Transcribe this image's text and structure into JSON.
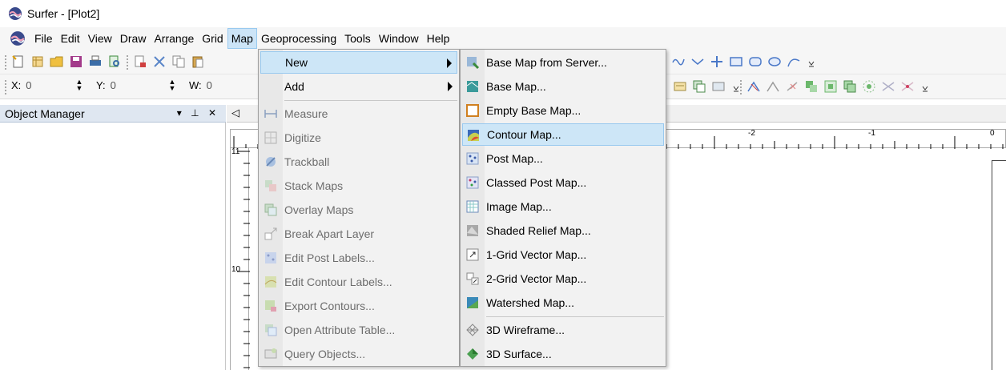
{
  "window": {
    "title": "Surfer - [Plot2]"
  },
  "menubar": {
    "items": [
      "File",
      "Edit",
      "View",
      "Draw",
      "Arrange",
      "Grid",
      "Map",
      "Geoprocessing",
      "Tools",
      "Window",
      "Help"
    ],
    "active": "Map"
  },
  "coords": {
    "x_label": "X:",
    "x_value": "0",
    "y_label": "Y:",
    "y_value": "0",
    "w_label": "W:",
    "w_value": "0"
  },
  "object_manager": {
    "title": "Object Manager",
    "controls": "▾ ⊥ ✕"
  },
  "plot_tab": {
    "arrow": "◁"
  },
  "ruler": {
    "h_labels": [
      "-2",
      "-1",
      "0"
    ],
    "v_labels": [
      "11",
      "10"
    ]
  },
  "map_menu": {
    "items": [
      {
        "label": "New",
        "submenu": true,
        "highlighted": true,
        "disabled": false,
        "icon": "none"
      },
      {
        "label": "Add",
        "submenu": true,
        "highlighted": false,
        "disabled": false,
        "icon": "none"
      },
      {
        "label": "Measure",
        "disabled": true,
        "icon": "measure-icon"
      },
      {
        "label": "Digitize",
        "disabled": true,
        "icon": "digitize-icon"
      },
      {
        "label": "Trackball",
        "disabled": true,
        "icon": "trackball-icon"
      },
      {
        "label": "Stack Maps",
        "disabled": true,
        "icon": "stack-maps-icon"
      },
      {
        "label": "Overlay Maps",
        "disabled": true,
        "icon": "overlay-maps-icon"
      },
      {
        "label": "Break Apart Layer",
        "disabled": true,
        "icon": "break-apart-icon"
      },
      {
        "label": "Edit Post Labels...",
        "disabled": true,
        "icon": "edit-post-labels-icon"
      },
      {
        "label": "Edit Contour Labels...",
        "disabled": true,
        "icon": "edit-contour-labels-icon"
      },
      {
        "label": "Export Contours...",
        "disabled": true,
        "icon": "export-contours-icon"
      },
      {
        "label": "Open Attribute Table...",
        "disabled": true,
        "icon": "attribute-table-icon"
      },
      {
        "label": "Query Objects...",
        "disabled": true,
        "icon": "query-objects-icon"
      }
    ]
  },
  "new_submenu": {
    "items": [
      {
        "label": "Base Map from Server...",
        "icon": "base-map-server-icon"
      },
      {
        "label": "Base Map...",
        "icon": "base-map-icon"
      },
      {
        "label": "Empty Base Map...",
        "icon": "empty-base-map-icon"
      },
      {
        "label": "Contour Map...",
        "icon": "contour-map-icon",
        "highlighted": true
      },
      {
        "label": "Post Map...",
        "icon": "post-map-icon"
      },
      {
        "label": "Classed Post Map...",
        "icon": "classed-post-map-icon"
      },
      {
        "label": "Image Map...",
        "icon": "image-map-icon"
      },
      {
        "label": "Shaded Relief Map...",
        "icon": "shaded-relief-icon"
      },
      {
        "label": "1-Grid Vector Map...",
        "icon": "vector-1-icon"
      },
      {
        "label": "2-Grid Vector Map...",
        "icon": "vector-2-icon"
      },
      {
        "label": "Watershed Map...",
        "icon": "watershed-icon"
      },
      {
        "label": "3D Wireframe...",
        "icon": "wireframe-icon"
      },
      {
        "label": "3D Surface...",
        "icon": "surface-icon"
      }
    ]
  },
  "colors": {
    "highlight": "#cde6f7",
    "highlight_border": "#99c9ef",
    "panel_header": "#dfe7f1"
  }
}
